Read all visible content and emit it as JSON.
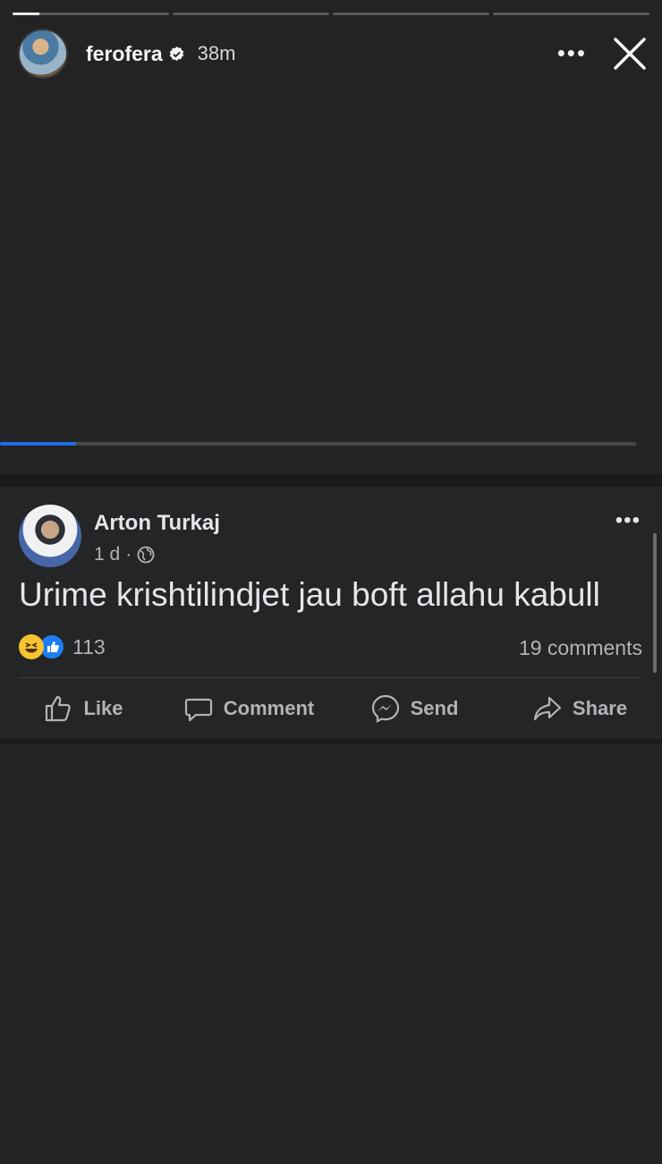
{
  "story": {
    "username": "ferofera",
    "time_ago": "38m",
    "segments": [
      {
        "progress": 0.17
      },
      {
        "progress": 0
      },
      {
        "progress": 0
      },
      {
        "progress": 0
      }
    ]
  },
  "video": {
    "played_fraction": 0.12
  },
  "post": {
    "author": "Arton Turkaj",
    "time": "1 d",
    "separator": "·",
    "text": "Urime krishtilindjet jau boft allahu kabull",
    "reactions_count": "113",
    "comments": "19 comments",
    "actions": [
      {
        "label": "Like",
        "icon": "like-icon"
      },
      {
        "label": "Comment",
        "icon": "comment-icon"
      },
      {
        "label": "Send",
        "icon": "messenger-icon"
      },
      {
        "label": "Share",
        "icon": "share-icon"
      }
    ]
  },
  "colors": {
    "accent": "#1f6ee6",
    "background": "#232323",
    "card": "#242526"
  }
}
